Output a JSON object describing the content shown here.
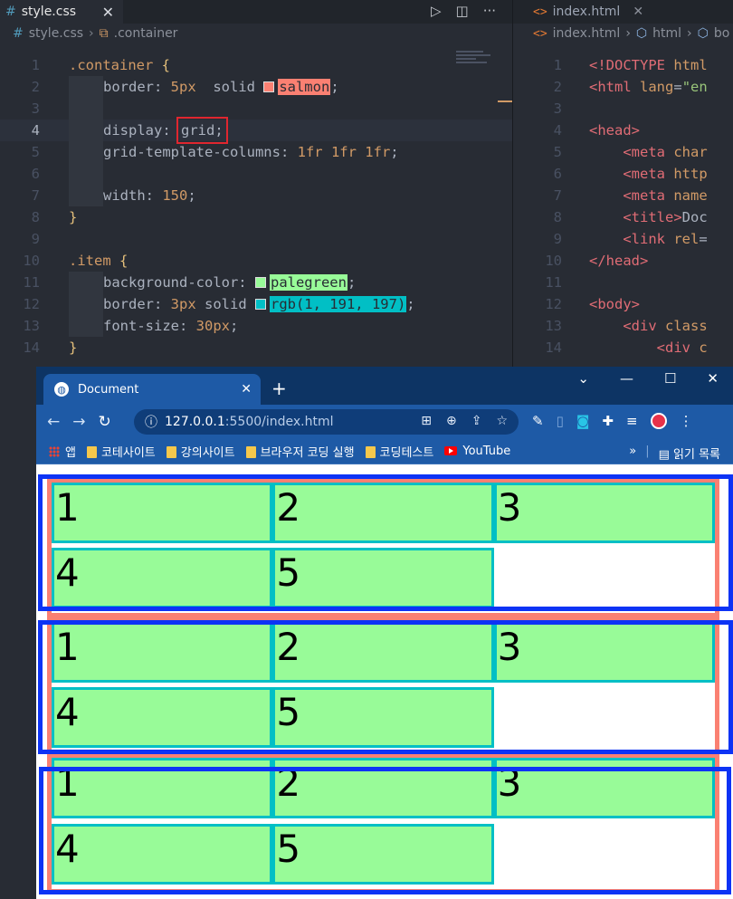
{
  "css_editor": {
    "tab_label": "style.css",
    "breadcrumb": {
      "file": "style.css",
      "selector": ".container"
    },
    "lines": [
      {
        "n": "1",
        "html": "<span class=\"sel\">.container</span> <span class=\"brace\">{</span>"
      },
      {
        "n": "2",
        "html": "<span class=\"indent\"></span>border: <span class=\"num\">5px</span>  solid <span class=\"swatch\" style=\"background:#fa8072\"></span><span class=\"hl-salmon\">salmon</span>;"
      },
      {
        "n": "3",
        "html": "<span class=\"indent\"></span>"
      },
      {
        "n": "4",
        "html": "<span class=\"indent\"></span>display: <span class=\"redbox\">grid;</span>",
        "current": true
      },
      {
        "n": "5",
        "html": "<span class=\"indent\"></span>grid-template-columns: <span class=\"num\">1fr 1fr 1fr</span>;"
      },
      {
        "n": "6",
        "html": "<span class=\"indent\"></span>"
      },
      {
        "n": "7",
        "html": "<span class=\"indent\"></span>width: <span class=\"num\">150</span>;"
      },
      {
        "n": "8",
        "html": "<span class=\"brace\">}</span>"
      },
      {
        "n": "9",
        "html": ""
      },
      {
        "n": "10",
        "html": "<span class=\"sel\">.item</span> <span class=\"brace\">{</span>"
      },
      {
        "n": "11",
        "html": "<span class=\"indent\"></span>background-color: <span class=\"swatch\" style=\"background:#98fb98\"></span><span class=\"hl-green\">palegreen</span>;"
      },
      {
        "n": "12",
        "html": "<span class=\"indent\"></span>border: <span class=\"num\">3px</span> solid <span class=\"swatch\" style=\"background:#01bfc5\"></span><span class=\"hl-rgb\">rgb(1, 191, 197)</span>;"
      },
      {
        "n": "13",
        "html": "<span class=\"indent\"></span>font-size: <span class=\"num\">30px</span>;"
      },
      {
        "n": "14",
        "html": "<span class=\"brace\">}</span>"
      }
    ]
  },
  "html_editor": {
    "tab_label": "index.html",
    "breadcrumb": {
      "file": "index.html",
      "node1": "html",
      "node2": "bo"
    },
    "lines": [
      {
        "n": "1",
        "html": "<span class=\"tag\">&lt;!DOCTYPE</span> <span class=\"attr\">html</span>"
      },
      {
        "n": "2",
        "html": "<span class=\"tag\">&lt;html</span> <span class=\"attr\">lang</span>=<span class=\"str\">\"en</span>"
      },
      {
        "n": "3",
        "html": ""
      },
      {
        "n": "4",
        "html": "<span class=\"tag\">&lt;head&gt;</span>"
      },
      {
        "n": "5",
        "html": "    <span class=\"tag\">&lt;meta</span> <span class=\"attr\">char</span>"
      },
      {
        "n": "6",
        "html": "    <span class=\"tag\">&lt;meta</span> <span class=\"attr\">http</span>"
      },
      {
        "n": "7",
        "html": "    <span class=\"tag\">&lt;meta</span> <span class=\"attr\">name</span>"
      },
      {
        "n": "8",
        "html": "    <span class=\"tag\">&lt;title&gt;</span><span class=\"plain\">Doc</span>"
      },
      {
        "n": "9",
        "html": "    <span class=\"tag\">&lt;link</span> <span class=\"attr\">rel</span>="
      },
      {
        "n": "10",
        "html": "<span class=\"tag\">&lt;/head&gt;</span>"
      },
      {
        "n": "11",
        "html": ""
      },
      {
        "n": "12",
        "html": "<span class=\"tag\">&lt;body&gt;</span>"
      },
      {
        "n": "13",
        "html": "    <span class=\"tag\">&lt;div</span> <span class=\"attr\">class</span>"
      },
      {
        "n": "14",
        "html": "        <span class=\"tag\">&lt;div</span> <span class=\"attr\">c</span>"
      }
    ]
  },
  "browser": {
    "tab_title": "Document",
    "url_host": "127.0.0.1",
    "url_rest": ":5500/index.html",
    "bookmarks": [
      "앱",
      "코테사이트",
      "강의사이트",
      "브라우저 코딩 실행",
      "코딩테스트",
      "YouTube"
    ],
    "reading_list": "읽기 목록",
    "grids": [
      {
        "items": [
          "1",
          "2",
          "3",
          "4",
          "5"
        ]
      },
      {
        "items": [
          "1",
          "2",
          "3",
          "4",
          "5"
        ]
      },
      {
        "items": [
          "1",
          "2",
          "3",
          "4",
          "5"
        ]
      }
    ]
  },
  "colors": {
    "salmon": "#fa8072",
    "palegreen": "#98fb98",
    "cyan": "#01bfc5",
    "highlight_box": "#0d33f5",
    "red_box": "#e0262f"
  }
}
